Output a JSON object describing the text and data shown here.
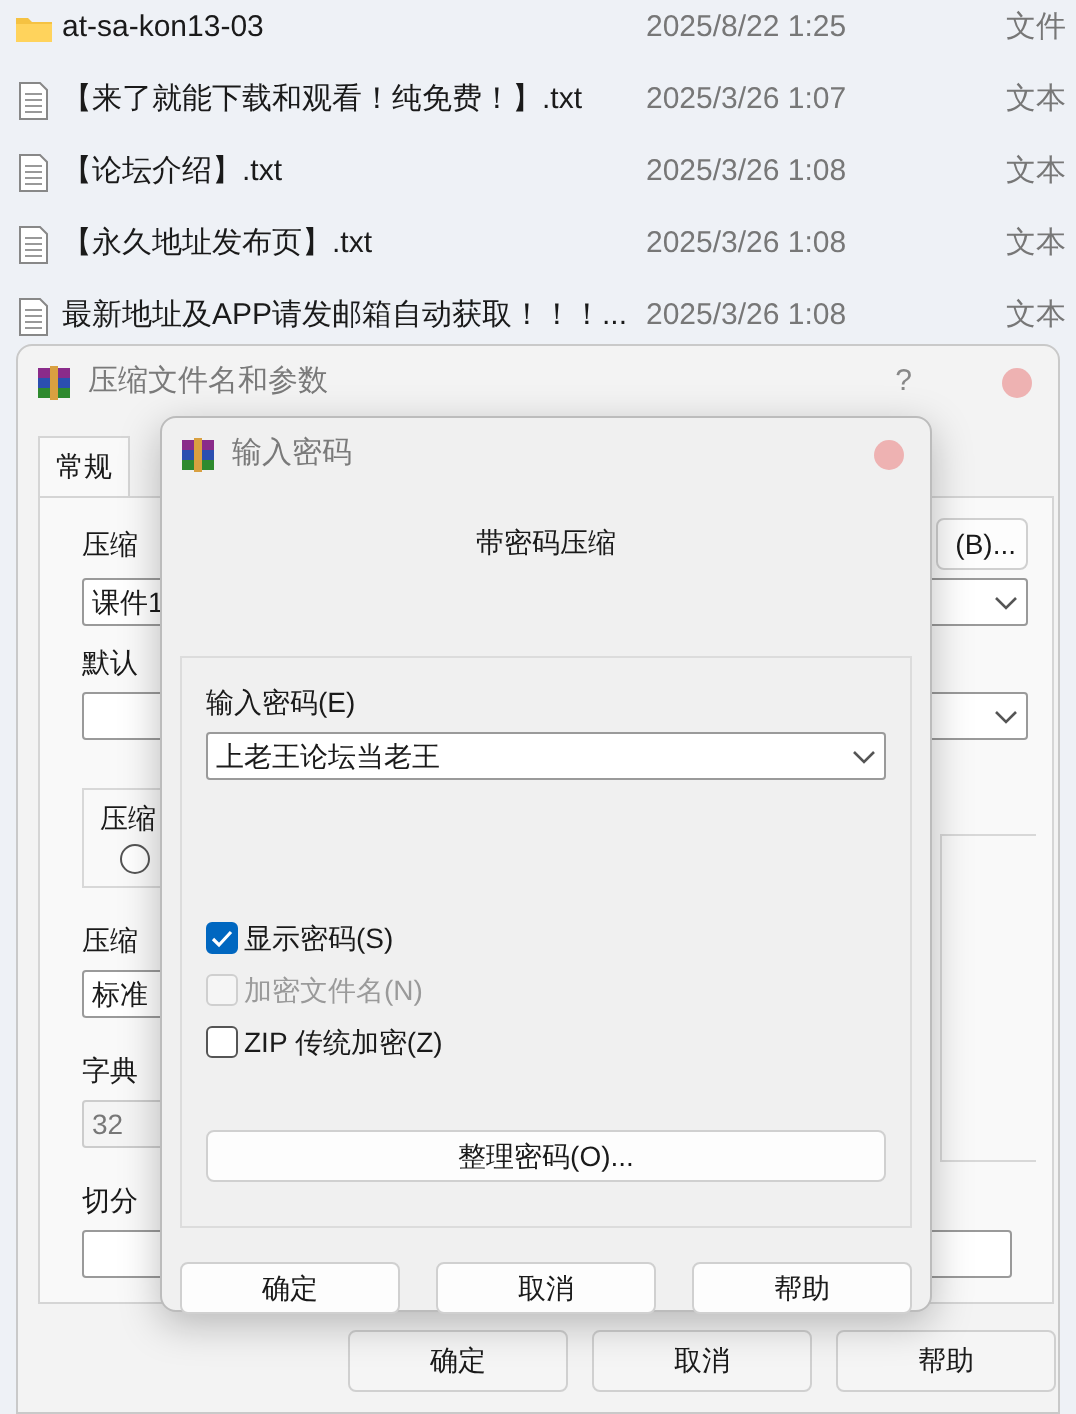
{
  "file_list": [
    {
      "kind": "folder",
      "name": "at-sa-kon13-03",
      "modified": "2025/8/22 1:25",
      "type": "文件"
    },
    {
      "kind": "text",
      "name": "【来了就能下载和观看！纯免费！】.txt",
      "modified": "2025/3/26 1:07",
      "type": "文本"
    },
    {
      "kind": "text",
      "name": "【论坛介绍】.txt",
      "modified": "2025/3/26 1:08",
      "type": "文本"
    },
    {
      "kind": "text",
      "name": "【永久地址发布页】.txt",
      "modified": "2025/3/26 1:08",
      "type": "文本"
    },
    {
      "kind": "text",
      "name": "最新地址及APP请发邮箱自动获取！！！...",
      "modified": "2025/3/26 1:08",
      "type": "文本"
    }
  ],
  "archive_dialog": {
    "title": "压缩文件名和参数",
    "help": "?",
    "tabs": [
      {
        "label": "常规",
        "selected": true
      }
    ],
    "archive_name_label": "压缩",
    "browse_button": "(B)...",
    "archive_name": "课件1",
    "profile_label": "默认",
    "group_label": "压缩",
    "radio": {
      "selected": false
    },
    "method_label": "压缩",
    "method": "标准",
    "dictionary_label": "字典",
    "dictionary": "32",
    "split_label": "切分",
    "buttons": [
      "确定",
      "取消",
      "帮助"
    ]
  },
  "password_dialog": {
    "title": "输入密码",
    "heading": "带密码压缩",
    "password_label": "输入密码(E)",
    "password": "上老王论坛当老王",
    "options": [
      {
        "label": "显示密码(S)",
        "checked": true,
        "disabled": false
      },
      {
        "label": "加密文件名(N)",
        "checked": false,
        "disabled": true
      },
      {
        "label": "ZIP 传统加密(Z)",
        "checked": false,
        "disabled": false
      }
    ],
    "organize_button": "整理密码(O)...",
    "buttons": [
      "确定",
      "取消",
      "帮助"
    ]
  }
}
